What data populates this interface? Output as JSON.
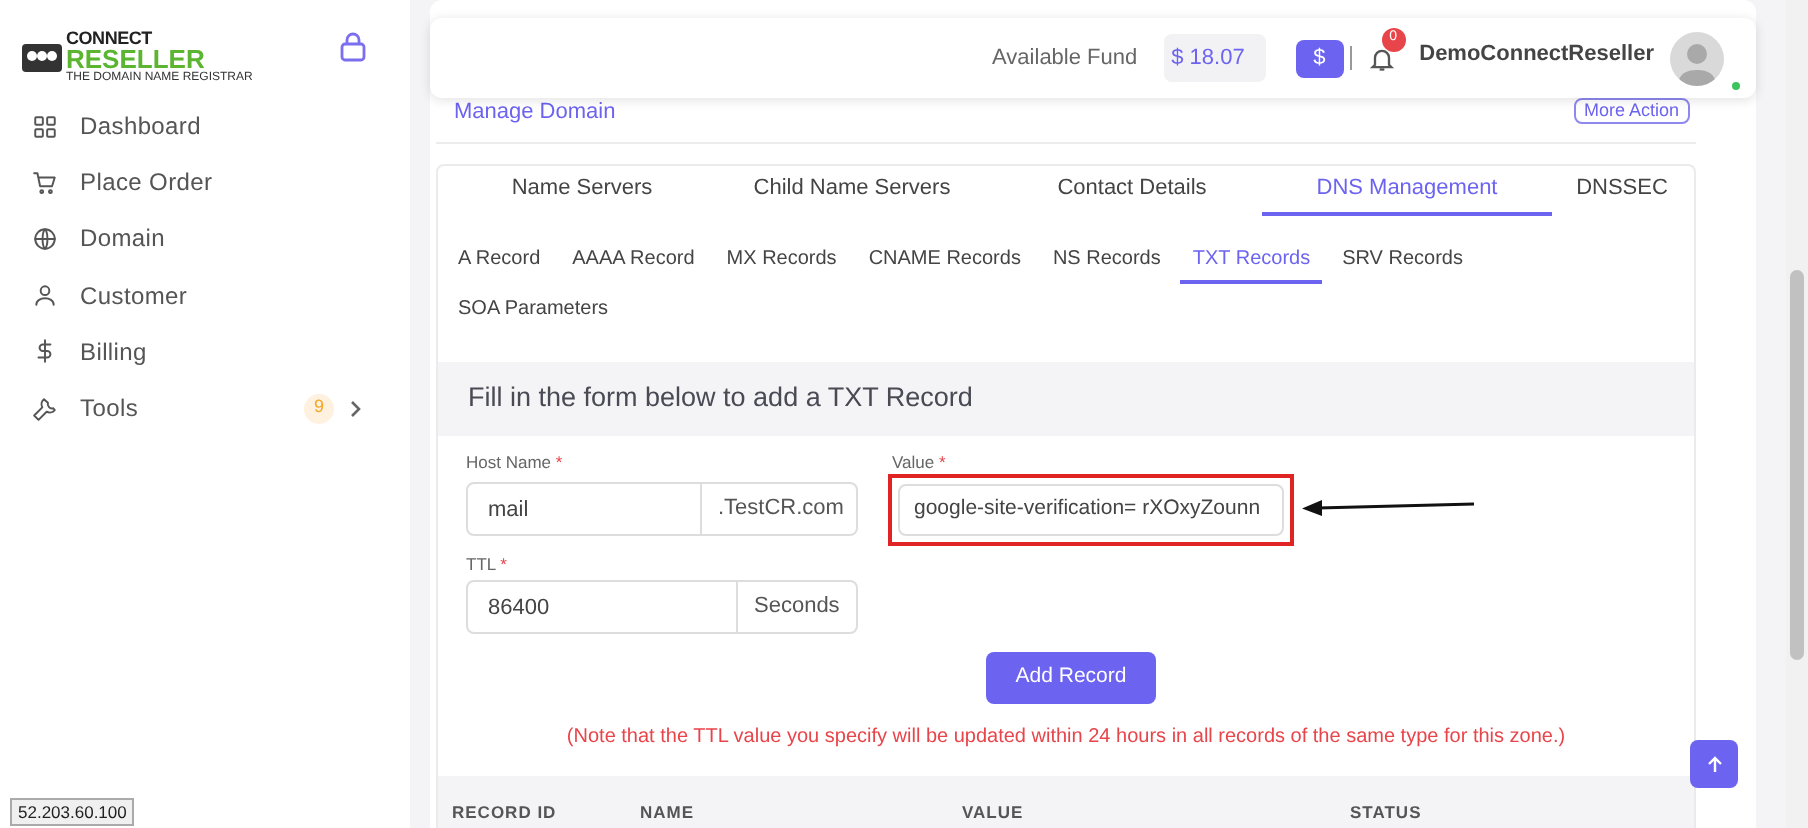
{
  "sidebar": {
    "logo": {
      "line_1": "CONNECT",
      "line_2": "RESELLER",
      "tagline": "THE DOMAIN NAME REGISTRAR"
    },
    "items": [
      {
        "label": "Dashboard"
      },
      {
        "label": "Place Order"
      },
      {
        "label": "Domain"
      },
      {
        "label": "Customer"
      },
      {
        "label": "Billing"
      },
      {
        "label": "Tools",
        "badge": "9",
        "expandable": true
      }
    ]
  },
  "header": {
    "fund_label": "Available Fund",
    "fund_value": "$ 18.07",
    "add_fund_button": "$",
    "notifications": "0",
    "user_name": "DemoConnectReseller",
    "online": true
  },
  "page": {
    "title": "Manage Domain",
    "action_button": "More Action"
  },
  "tabs": [
    {
      "label": "Name Servers",
      "selected": false
    },
    {
      "label": "Child Name Servers",
      "selected": false
    },
    {
      "label": "Contact Details",
      "selected": false
    },
    {
      "label": "DNS Management",
      "selected": true
    },
    {
      "label": "DNSSEC",
      "selected": false
    }
  ],
  "record_tabs": [
    {
      "label": "A Record",
      "selected": false
    },
    {
      "label": "AAAA Record",
      "selected": false
    },
    {
      "label": "MX Records",
      "selected": false
    },
    {
      "label": "CNAME Records",
      "selected": false
    },
    {
      "label": "NS Records",
      "selected": false
    },
    {
      "label": "TXT Records",
      "selected": true
    },
    {
      "label": "SRV Records",
      "selected": false
    },
    {
      "label": "SOA Parameters",
      "selected": false
    }
  ],
  "form": {
    "title": "Fill in the form below to add a TXT Record",
    "host_name": {
      "label": "Host Name",
      "required_mark": "*",
      "value": "mail",
      "suffix": ".TestCR.com"
    },
    "value": {
      "label": "Value",
      "required_mark": "*",
      "value": "google-site-verification= rXOxyZounn",
      "highlighted": true
    },
    "ttl": {
      "label": "TTL",
      "required_mark": "*",
      "value": "86400",
      "suffix": "Seconds"
    },
    "submit_button": "Add Record",
    "note": "(Note that the TTL value you specify will be updated within 24 hours in all records of the same type for this zone.)"
  },
  "table": {
    "columns": [
      "RECORD ID",
      "NAME",
      "VALUE",
      "STATUS"
    ]
  },
  "status_tooltip": "52.203.60.100"
}
